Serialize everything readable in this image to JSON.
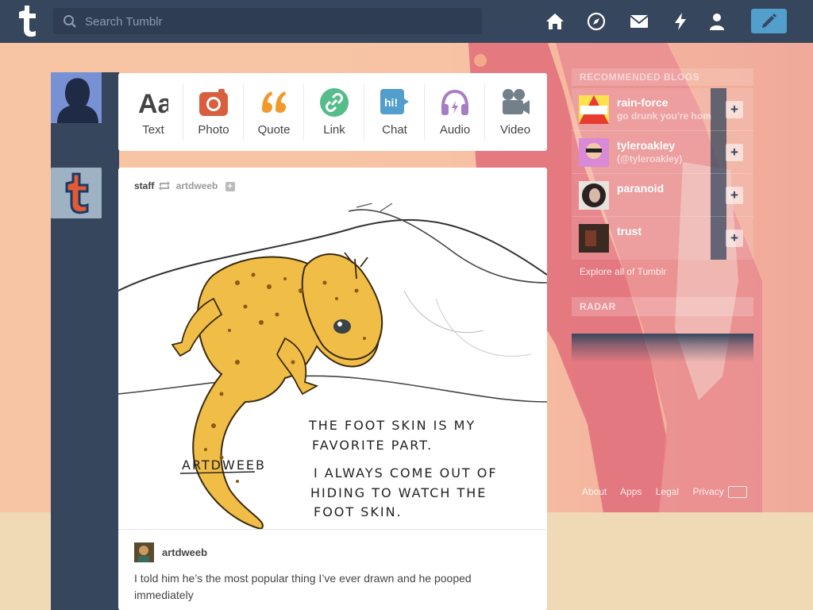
{
  "search": {
    "placeholder": "Search Tumblr"
  },
  "nav": {
    "icons": [
      "home-icon",
      "explore-icon",
      "messages-icon",
      "activity-icon",
      "account-icon"
    ],
    "compose_icon": "pencil-icon"
  },
  "post_types": [
    {
      "label": "Text",
      "icon": "text-icon",
      "color": "#444444"
    },
    {
      "label": "Photo",
      "icon": "camera-icon",
      "color": "#d95e40"
    },
    {
      "label": "Quote",
      "icon": "quote-icon",
      "color": "#f2992e"
    },
    {
      "label": "Link",
      "icon": "link-icon",
      "color": "#56bc8a"
    },
    {
      "label": "Chat",
      "icon": "chat-icon",
      "color": "#529ecc"
    },
    {
      "label": "Audio",
      "icon": "headphones-icon",
      "color": "#a77dc2"
    },
    {
      "label": "Video",
      "icon": "video-camera-icon",
      "color": "#748089"
    }
  ],
  "post": {
    "reblogger": "staff",
    "source": "artdweeb",
    "artwork_text": {
      "signature": "ARTDWEEB",
      "line1": "THE FOOT SKIN IS MY",
      "line2": "FAVORITE PART.",
      "line3": "I ALWAYS COME OUT OF",
      "line4": "HIDING TO WATCH THE",
      "line5": "FOOT SKIN."
    },
    "author": "artdweeb",
    "caption": "I told him he’s the most popular thing I’ve ever drawn and he pooped immediately"
  },
  "sidebar": {
    "recommended_title": "RECOMMENDED BLOGS",
    "blogs": [
      {
        "name": "rain-force",
        "subtitle": "go drunk you're hom"
      },
      {
        "name": "tyleroakley",
        "subtitle": "(@tyleroakley)"
      },
      {
        "name": "paranoid",
        "subtitle": ""
      },
      {
        "name": "trust",
        "subtitle": ""
      }
    ],
    "explore": "Explore all of Tumblr",
    "radar_title": "RADAR"
  },
  "footer": {
    "links": [
      "About",
      "Apps",
      "Legal",
      "Privacy"
    ]
  },
  "colors": {
    "nav_bg": "#36465d",
    "accent": "#529ecc"
  }
}
